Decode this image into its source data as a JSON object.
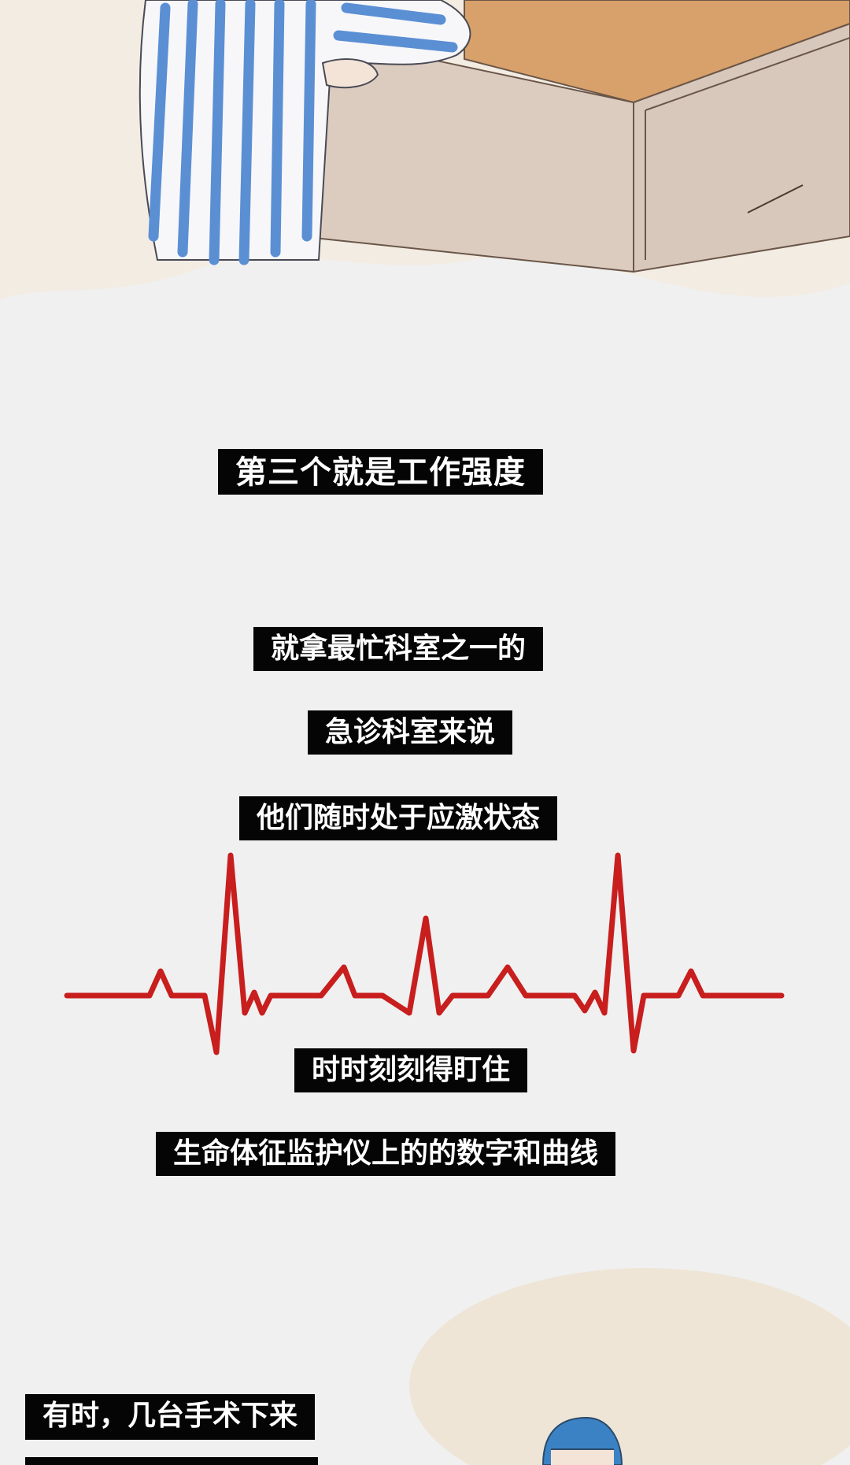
{
  "captions": {
    "title": "第三个就是工作强度",
    "line1": "就拿最忙科室之一的",
    "line2": "急诊科室来说",
    "line3": "他们随时处于应激状态",
    "line4": "时时刻刻得盯住",
    "line5": "生命体征监护仪上的的数字和曲线",
    "line6": "有时，几台手术下来"
  },
  "colors": {
    "background": "#f0f0f0",
    "caption_bg": "#050505",
    "caption_text": "#ffffff",
    "ecg_line": "#c81e1e",
    "pajama_stripe": "#5b8fd4",
    "box_top": "#d8a06a",
    "box_side": "#d8c8bc"
  },
  "icons": {
    "top_illustration": "patient-in-striped-pajamas-leaning-on-box",
    "middle_graphic": "heartbeat-ecg-line",
    "bottom_illustration": "doctor-in-surgical-cap"
  }
}
